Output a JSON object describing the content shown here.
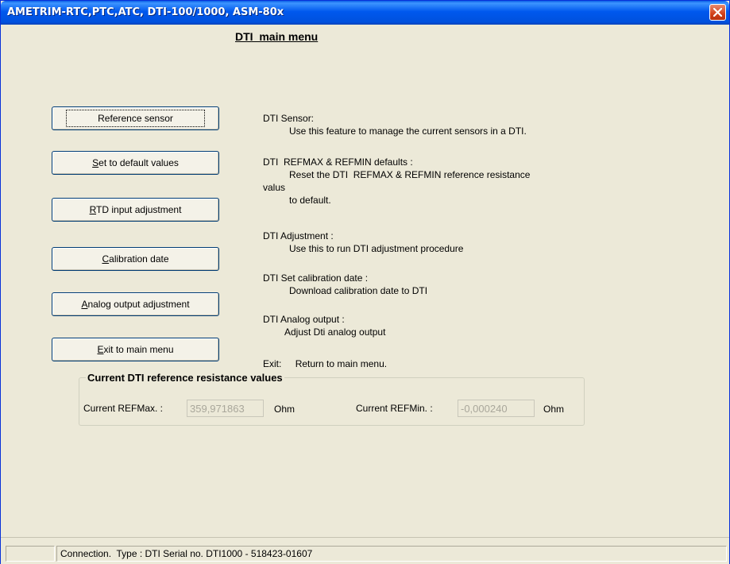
{
  "window": {
    "title": "AMETRIM-RTC,PTC,ATC, DTI-100/1000, ASM-80x",
    "close_icon": "close-icon"
  },
  "menu": {
    "title": "DTI  main menu"
  },
  "buttons": [
    {
      "label": "Reference sensor",
      "mnemonic": "",
      "rest": "Reference sensor"
    },
    {
      "label": "Set to default values",
      "mnemonic": "S",
      "rest": "et to default values"
    },
    {
      "label": "RTD input adjustment",
      "mnemonic": "R",
      "rest": "TD input adjustment"
    },
    {
      "label": "Calibration date",
      "mnemonic": "C",
      "rest": "alibration date"
    },
    {
      "label": "Analog output adjustment",
      "mnemonic": "A",
      "rest": "nalog output adjustment"
    },
    {
      "label": "Exit to main menu",
      "mnemonic": "E",
      "rest": "xit to main menu"
    }
  ],
  "descriptions": {
    "sensor_title": "DTI Sensor:",
    "sensor_text": "Use this feature to manage the current sensors in a DTI.",
    "defaults_title": "DTI  REFMAX & REFMIN defaults :",
    "defaults_text1": "Reset the DTI  REFMAX & REFMIN reference resistance",
    "defaults_text2": "valus",
    "defaults_text3": "to default.",
    "adjust_title": "DTI Adjustment :",
    "adjust_text": "Use this to run DTI adjustment procedure",
    "calib_title": "DTI Set calibration date :",
    "calib_text": "Download calibration date to DTI",
    "analog_title": "DTI Analog output :",
    "analog_text": "Adjust Dti analog output",
    "exit_title": "Exit:",
    "exit_text": "Return to main menu."
  },
  "reference_group": {
    "legend": "Current DTI reference resistance values",
    "refmax_label": "Current REFMax. :",
    "refmax_value": "359,971863",
    "refmax_unit": "Ohm",
    "refmin_label": "Current REFMin. :",
    "refmin_value": "-0,000240",
    "refmin_unit": "Ohm"
  },
  "statusbar": {
    "pane1": "",
    "text": "Connection.  Type : DTI Serial no. DTI1000 - 518423-01607"
  }
}
